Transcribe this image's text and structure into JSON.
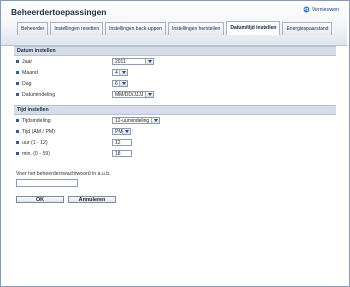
{
  "app": {
    "title": "Beheerdertoepassingen"
  },
  "refresh": {
    "label": "Vernieuwen",
    "icon": "refresh-icon"
  },
  "tabs": [
    {
      "label": "Beheerder"
    },
    {
      "label": "Instellingen resetten"
    },
    {
      "label": "Instellingen back-uppen"
    },
    {
      "label": "Instellingen herstellen"
    },
    {
      "label": "Datum/tijd instellen",
      "active": true
    },
    {
      "label": "Energiespaarstand"
    }
  ],
  "date_section": {
    "title": "Datum instellen",
    "rows": [
      {
        "label": "Jaar",
        "value": "2011"
      },
      {
        "label": "Maand",
        "value": "4"
      },
      {
        "label": "Dag",
        "value": "6"
      },
      {
        "label": "Datumindeling",
        "value": "MM/DD/JJJJ"
      }
    ]
  },
  "time_section": {
    "title": "Tijd instellen",
    "rows": [
      {
        "label": "Tijdsindeling",
        "value": "12-uursindeling"
      },
      {
        "label": "Tijd (AM / PM)",
        "value": "PM"
      },
      {
        "label": "uur (1 - 12)",
        "value": "12"
      },
      {
        "label": "min. (0 - 59)",
        "value": "18"
      }
    ]
  },
  "password": {
    "label": "Voer het beheerderswachtwoord in a.u.b.",
    "value": ""
  },
  "buttons": {
    "ok": "OK",
    "cancel": "Annuleren"
  },
  "colors": {
    "accent": "#3a5a8c",
    "section_bg": "#d6dde8",
    "header_bg": "#dfe5ee"
  }
}
